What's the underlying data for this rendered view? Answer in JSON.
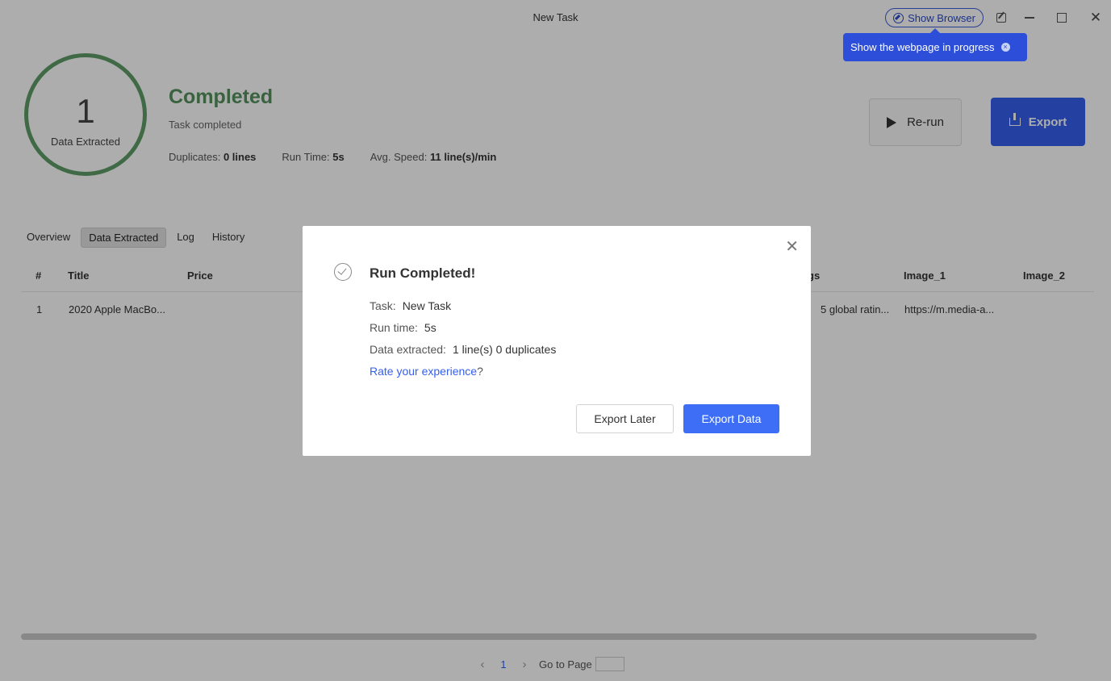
{
  "window": {
    "title": "New Task",
    "show_browser_label": "Show Browser",
    "tooltip": "Show the webpage in progress"
  },
  "summary": {
    "count": "1",
    "count_label": "Data Extracted",
    "status": "Completed",
    "status_sub": "Task completed",
    "duplicates_label": "Duplicates:",
    "duplicates_value": "0 lines",
    "runtime_label": "Run Time:",
    "runtime_value": "5s",
    "speed_label": "Avg. Speed:",
    "speed_value": "11 line(s)/min",
    "rerun_label": "Re-run",
    "export_label": "Export",
    "status_color": "#54915c",
    "accent_color": "#3560ee"
  },
  "tabs": [
    "Overview",
    "Data Extracted",
    "Log",
    "History"
  ],
  "table": {
    "columns": [
      "#",
      "Title",
      "Price",
      "",
      "",
      "",
      "",
      "gs",
      "Image_1",
      "Image_2"
    ],
    "rows": [
      [
        "1",
        "2020 Apple MacBo...",
        "",
        "",
        "",
        "",
        "",
        "5 global ratin...",
        "https://m.media-a...",
        ""
      ]
    ]
  },
  "pagination": {
    "current": "1",
    "goto_label": "Go to Page"
  },
  "modal": {
    "title": "Run Completed!",
    "task_label": "Task:",
    "task_value": "New Task",
    "runtime_label": "Run time:",
    "runtime_value": "5s",
    "extracted_label": "Data extracted:",
    "extracted_value": "1 line(s) 0 duplicates",
    "rate_link": "Rate your experience",
    "rate_suffix": "?",
    "export_later": "Export Later",
    "export_data": "Export Data"
  }
}
